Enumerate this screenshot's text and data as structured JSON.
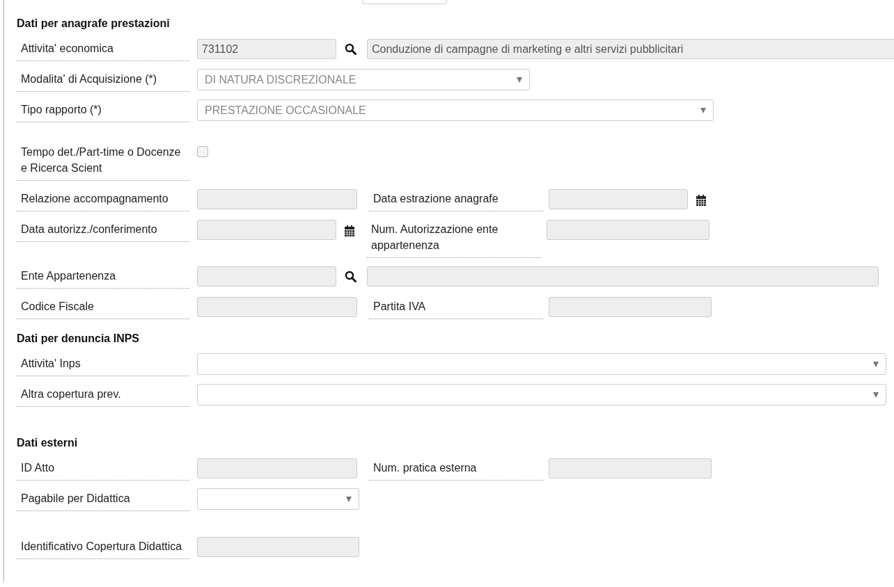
{
  "sections": [
    {
      "title": "Dati per anagrafe prestazioni",
      "rows": [
        {
          "label": "Attivita' economica",
          "controls": [
            {
              "kind": "input",
              "value": "731102"
            },
            {
              "kind": "search"
            },
            {
              "kind": "input",
              "value": "Conduzione di campagne di marketing e altri servizi pubblicitari"
            }
          ]
        },
        {
          "label": "Modalita' di Acquisizione (*)",
          "controls": [
            {
              "kind": "select",
              "value": "DI NATURA DISCREZIONALE"
            }
          ]
        },
        {
          "label": "Tipo rapporto (*)",
          "controls": [
            {
              "kind": "select",
              "value": "PRESTAZIONE OCCASIONALE"
            }
          ]
        },
        {
          "label": "Tempo det./Part-time o Docenze e Ricerca Scient",
          "controls": [
            {
              "kind": "checkbox",
              "checked": false
            }
          ]
        },
        {
          "label": "Relazione accompagnamento",
          "controls": [
            {
              "kind": "input"
            },
            {
              "kind": "label",
              "text": "Data estrazione anagrafe"
            },
            {
              "kind": "input"
            },
            {
              "kind": "calendar"
            }
          ]
        },
        {
          "label": "Data autorizz./conferimento",
          "controls": [
            {
              "kind": "input"
            },
            {
              "kind": "calendar"
            },
            {
              "kind": "label",
              "text": "Num. Autorizzazione ente appartenenza"
            },
            {
              "kind": "input"
            }
          ]
        },
        {
          "label": "Ente Appartenenza",
          "controls": [
            {
              "kind": "input"
            },
            {
              "kind": "search"
            },
            {
              "kind": "input"
            }
          ]
        },
        {
          "label": "Codice Fiscale",
          "controls": [
            {
              "kind": "input"
            },
            {
              "kind": "label",
              "text": "Partita IVA"
            },
            {
              "kind": "input"
            }
          ]
        }
      ]
    },
    {
      "title": "Dati per denuncia INPS",
      "rows": [
        {
          "label": "Attivita' Inps",
          "controls": [
            {
              "kind": "select"
            }
          ]
        },
        {
          "label": "Altra copertura prev.",
          "controls": [
            {
              "kind": "select"
            }
          ]
        }
      ]
    },
    {
      "title": "Dati esterni",
      "rows": [
        {
          "label": "ID Atto",
          "controls": [
            {
              "kind": "input"
            },
            {
              "kind": "label",
              "text": "Num. pratica esterna"
            },
            {
              "kind": "input"
            }
          ]
        },
        {
          "label": "Pagabile per Didattica",
          "controls": [
            {
              "kind": "select"
            }
          ]
        },
        {
          "label": "Identificativo Copertura Didattica",
          "controls": [
            {
              "kind": "input"
            }
          ]
        }
      ]
    }
  ]
}
